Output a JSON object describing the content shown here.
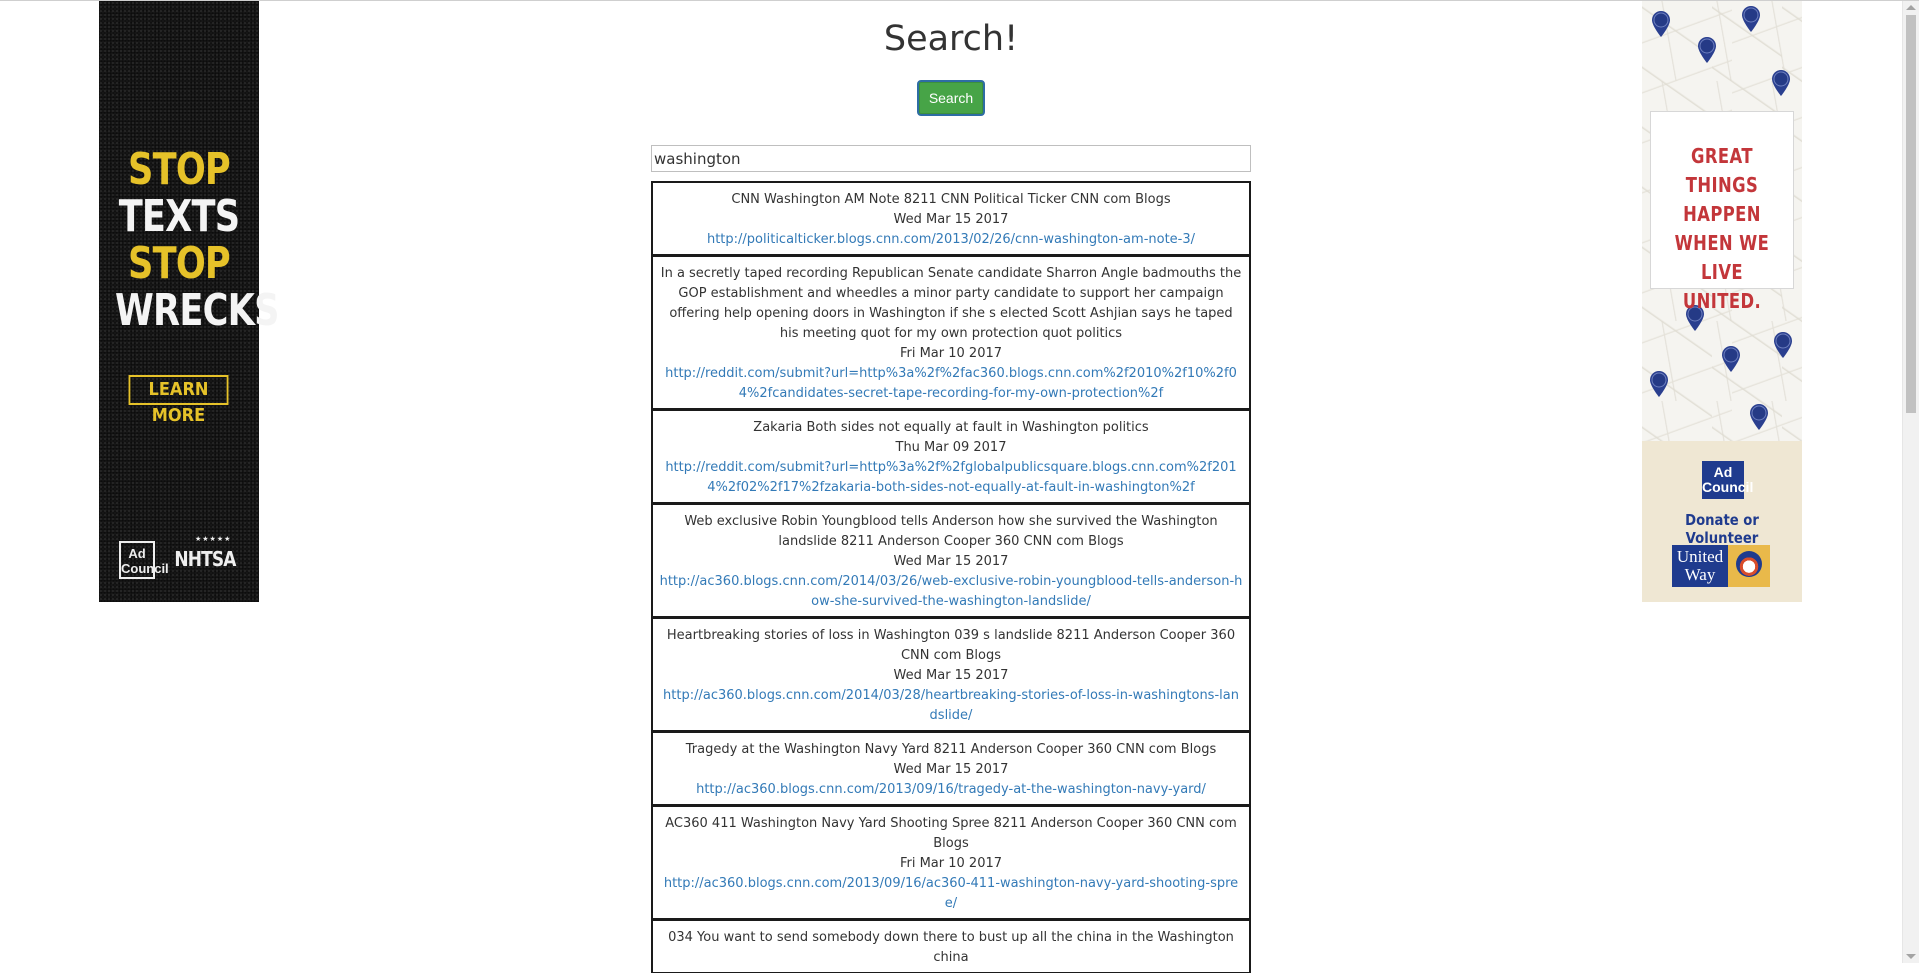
{
  "page": {
    "title": "Search!",
    "search_button_label": "Search",
    "search_query": "washington"
  },
  "ad_left": {
    "line1": "STOP",
    "line2": "TEXTS",
    "line3": "STOP",
    "line4": "WRECKS",
    "cta": "LEARN MORE",
    "logo1": "Ad Council",
    "logo2": "NHTSA"
  },
  "ad_right": {
    "message_lines": [
      "GREAT THINGS",
      "HAPPEN",
      "WHEN WE",
      "LIVE UNITED."
    ],
    "logo": "Ad Council",
    "cta": "Donate or Volunteer",
    "brand": "United Way"
  },
  "results": [
    {
      "title": "CNN Washington AM Note 8211 CNN Political Ticker CNN com Blogs",
      "date": "Wed Mar 15 2017",
      "url": "http://politicalticker.blogs.cnn.com/2013/02/26/cnn-washington-am-note-3/"
    },
    {
      "title": "In a secretly taped recording Republican Senate candidate Sharron Angle badmouths the GOP establishment and wheedles a minor party candidate to support her campaign offering help opening doors in Washington if she s elected Scott Ashjian says he taped his meeting quot for my own protection quot politics",
      "date": "Fri Mar 10 2017",
      "url": "http://reddit.com/submit?url=http%3a%2f%2fac360.blogs.cnn.com%2f2010%2f10%2f04%2fcandidates-secret-tape-recording-for-my-own-protection%2f"
    },
    {
      "title": "Zakaria Both sides not equally at fault in Washington politics",
      "date": "Thu Mar 09 2017",
      "url": "http://reddit.com/submit?url=http%3a%2f%2fglobalpublicsquare.blogs.cnn.com%2f2014%2f02%2f17%2fzakaria-both-sides-not-equally-at-fault-in-washington%2f"
    },
    {
      "title": "Web exclusive Robin Youngblood tells Anderson how she survived the Washington landslide 8211 Anderson Cooper 360 CNN com Blogs",
      "date": "Wed Mar 15 2017",
      "url": "http://ac360.blogs.cnn.com/2014/03/26/web-exclusive-robin-youngblood-tells-anderson-how-she-survived-the-washington-landslide/"
    },
    {
      "title": "Heartbreaking stories of loss in Washington 039 s landslide 8211 Anderson Cooper 360 CNN com Blogs",
      "date": "Wed Mar 15 2017",
      "url": "http://ac360.blogs.cnn.com/2014/03/28/heartbreaking-stories-of-loss-in-washingtons-landslide/"
    },
    {
      "title": "Tragedy at the Washington Navy Yard 8211 Anderson Cooper 360 CNN com Blogs",
      "date": "Wed Mar 15 2017",
      "url": "http://ac360.blogs.cnn.com/2013/09/16/tragedy-at-the-washington-navy-yard/"
    },
    {
      "title": "AC360 411 Washington Navy Yard Shooting Spree 8211 Anderson Cooper 360 CNN com Blogs",
      "date": "Fri Mar 10 2017",
      "url": "http://ac360.blogs.cnn.com/2013/09/16/ac360-411-washington-navy-yard-shooting-spree/"
    },
    {
      "title": "034 You want to send somebody down there to bust up all the china in the Washington china",
      "date": "",
      "url": ""
    }
  ],
  "colors": {
    "button_green": "#47a447",
    "link_blue": "#337ab7",
    "ad_yellow": "#e6c229",
    "ad_red": "#c3363a",
    "ad_navy": "#1f3b8e"
  }
}
